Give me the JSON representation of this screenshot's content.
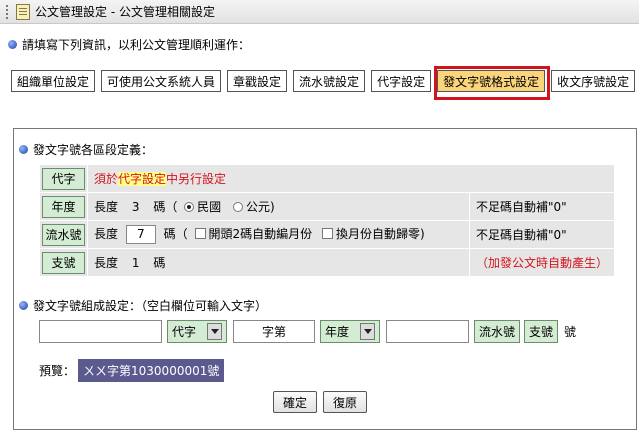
{
  "titlebar": {
    "title": "公文管理設定 - 公文管理相關設定"
  },
  "intro": "請填寫下列資訊，以利公文管理順利運作：",
  "tabs": [
    {
      "label": "組織單位設定"
    },
    {
      "label": "可使用公文系統人員"
    },
    {
      "label": "章戳設定"
    },
    {
      "label": "流水號設定"
    },
    {
      "label": "代字設定"
    },
    {
      "label": "發文字號格式設定"
    },
    {
      "label": "收文序號設定"
    }
  ],
  "section1": {
    "title": "發文字號各區段定義："
  },
  "rows": {
    "r1": {
      "label": "代字",
      "pre": "須於",
      "link": "代字設定",
      "post": "中另行設定"
    },
    "r2": {
      "label": "年度",
      "len_label": "長度",
      "len": "3",
      "unit": "碼（",
      "opt1": "民國",
      "opt2": "公元)",
      "note": "不足碼自動補\"0\""
    },
    "r3": {
      "label": "流水號",
      "len_label": "長度",
      "len": "7",
      "unit": "碼（",
      "chk1": "開頭2碼自動編月份",
      "chk2": "換月份自動歸零)",
      "note": "不足碼自動補\"0\""
    },
    "r4": {
      "label": "支號",
      "len_label": "長度",
      "len": "1",
      "unit": "碼",
      "note": "（加發公文時自動產生）"
    }
  },
  "section2": {
    "title": "發文字號組成設定：（空白欄位可輸入文字）"
  },
  "compose": {
    "field1": "",
    "code": "代字",
    "field2": "字第",
    "year": "年度",
    "field3": "",
    "serial": "流水號",
    "sub": "支號",
    "suffix": "號"
  },
  "preview": {
    "label": "預覽：",
    "value": "ㄨㄨ字第1030000001號"
  },
  "buttons": {
    "ok": "確定",
    "reset": "復原"
  },
  "colors": {
    "active_tab": "#fbd57b",
    "highlight_border": "#d4141c",
    "label_green": "#d4ecd4",
    "preview_bg": "#5b5a8e"
  }
}
